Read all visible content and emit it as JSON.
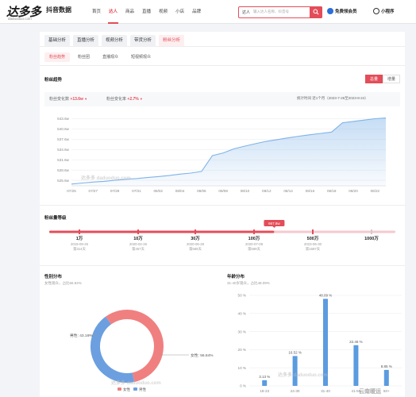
{
  "header": {
    "logo_text": "达多多",
    "logo_sub": "抖音数据",
    "logo_url": "daduoduo.com",
    "nav": [
      "首页",
      "达人",
      "商品",
      "直播",
      "视频",
      "小店",
      "品牌"
    ],
    "active_nav_index": 1,
    "search_type": "达人",
    "search_placeholder": "输入达人名称、抖音号",
    "links": [
      "免费领会员",
      "小程序"
    ]
  },
  "tabs": [
    "基础分析",
    "直播分析",
    "视频分析",
    "带货分析",
    "粉丝分析"
  ],
  "active_tab_index": 4,
  "subtabs": [
    "粉丝趋势",
    "粉丝团",
    "直播观众",
    "短视频观众"
  ],
  "active_subtab_index": 0,
  "trend": {
    "title": "粉丝趋势",
    "toggle": [
      "总量",
      "增量"
    ],
    "toggle_active_index": 0,
    "stat1_label": "粉丝变化数",
    "stat1_value": "+13.6w",
    "stat2_label": "粉丝变化率",
    "stat2_value": "+2.7%",
    "range_label": "统计时间",
    "range_value": "近1个月（2023-7-26至2023-8-24）"
  },
  "chart_data": [
    {
      "type": "area",
      "y_ticks": [
        "525.6w",
        "528.6w",
        "531.6w",
        "534.6w",
        "537.6w",
        "540.6w",
        "543.6w"
      ],
      "ylim": [
        524.0,
        544.4
      ],
      "x_ticks": [
        "07/25",
        "07/27",
        "07/29",
        "07/31",
        "08/02",
        "08/04",
        "08/06",
        "08/08",
        "08/10",
        "08/12",
        "08/14",
        "08/16",
        "08/18",
        "08/20",
        "08/22"
      ],
      "x": [
        0,
        1,
        2,
        3,
        4,
        5,
        6,
        7,
        8,
        9,
        10,
        11,
        12,
        13,
        14,
        15,
        16,
        17,
        18,
        19,
        20,
        21,
        22,
        23,
        24,
        25,
        26,
        27,
        28,
        29
      ],
      "values": [
        524.5,
        524.8,
        525.1,
        525.3,
        525.6,
        525.9,
        526.1,
        526.4,
        526.7,
        527.0,
        527.4,
        527.7,
        528.2,
        532.8,
        533.6,
        534.8,
        535.6,
        536.3,
        537.0,
        537.5,
        538.0,
        538.5,
        538.9,
        539.3,
        539.7,
        542.4,
        542.8,
        543.2,
        543.6,
        543.8
      ],
      "color": "#7fb3e8"
    },
    {
      "type": "bar",
      "title": "年龄分布",
      "categories": [
        "18-23",
        "24-30",
        "31-40",
        "41-50",
        "50+"
      ],
      "values": [
        3.13,
        16.52,
        48.09,
        22.46,
        8.85
      ],
      "value_labels": [
        "3.13 %",
        "16.52 %",
        "48.09 %",
        "22.46 %",
        "8.85 %"
      ],
      "y_ticks": [
        "0 %",
        "10 %",
        "20 %",
        "30 %",
        "40 %",
        "50 %"
      ],
      "ylim": [
        0,
        50
      ],
      "color": "#5b9be0"
    },
    {
      "type": "pie",
      "title": "性别分布",
      "labels": [
        "女性",
        "男性"
      ],
      "values": [
        56.84,
        43.16
      ],
      "value_labels": [
        "女性: 56.84%",
        "男性: 43.16%"
      ],
      "colors": [
        "#f08080",
        "#6b9fe0"
      ]
    }
  ],
  "fan_level": {
    "title": "粉丝量等级",
    "current_badge": "667.8w",
    "current_fraction": 0.65,
    "levels": [
      {
        "label": "1万",
        "date": "2019-09-26",
        "days": "第314天"
      },
      {
        "label": "10万",
        "date": "2020-02-26",
        "days": "第467天"
      },
      {
        "label": "30万",
        "date": "2020-06-28",
        "days": "第589天"
      },
      {
        "label": "100万",
        "date": "2020-07-08",
        "days": "第599天"
      },
      {
        "label": "500万",
        "date": "2023-06-30",
        "days": "第1697天"
      },
      {
        "label": "1000万",
        "date": "",
        "days": ""
      }
    ]
  },
  "gender": {
    "title": "性别分布",
    "sub": "女性观众，占比56.84%"
  },
  "age": {
    "title": "年龄分布",
    "sub": "31-40岁观众，占比48.09%"
  },
  "watermarks": [
    "达多多 daduoduo.com",
    "达多多 daduoduo.com",
    "达多多 daduoduo.com"
  ],
  "corner_mark": "云南暖运",
  "colors": {
    "accent": "#e34d59",
    "line": "#7fb3e8",
    "female": "#f08080",
    "male": "#6b9fe0"
  }
}
